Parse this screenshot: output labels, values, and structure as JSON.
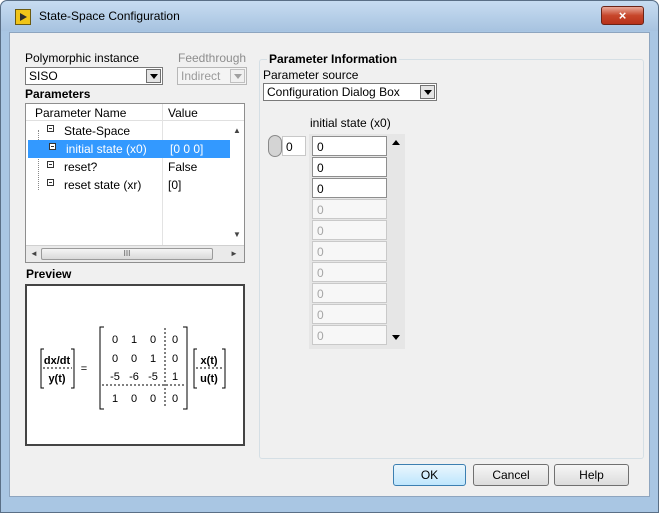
{
  "window": {
    "title": "State-Space Configuration",
    "close_glyph": "×"
  },
  "poly": {
    "label": "Polymorphic instance",
    "value": "SISO"
  },
  "feed": {
    "label": "Feedthrough",
    "value": "Indirect"
  },
  "params": {
    "label": "Parameters",
    "col_name": "Parameter Name",
    "col_value": "Value",
    "rows": [
      {
        "name": "State-Space",
        "value": ""
      },
      {
        "name": "initial state (x0)",
        "value": "[0 0 0]"
      },
      {
        "name": "reset?",
        "value": "False"
      },
      {
        "name": "reset state (xr)",
        "value": "[0]"
      }
    ],
    "scroll_grip": "III"
  },
  "preview": {
    "label": "Preview",
    "lhs": [
      "dx/dt",
      "y(t)"
    ],
    "eq": "=",
    "matrix": [
      [
        "0",
        "1",
        "0",
        "0"
      ],
      [
        "0",
        "0",
        "1",
        "0"
      ],
      [
        "-5",
        "-6",
        "-5",
        "1"
      ],
      [
        "1",
        "0",
        "0",
        "0"
      ]
    ],
    "rhs": [
      "x(t)",
      "u(t)"
    ]
  },
  "info": {
    "group_label": "Parameter Information",
    "source_label": "Parameter source",
    "source_value": "Configuration Dialog Box",
    "array_label": "initial state (x0)",
    "index": "0",
    "values": [
      "0",
      "0",
      "0",
      "0",
      "0",
      "0",
      "0",
      "0",
      "0",
      "0"
    ]
  },
  "buttons": {
    "ok": "OK",
    "cancel": "Cancel",
    "help": "Help"
  }
}
